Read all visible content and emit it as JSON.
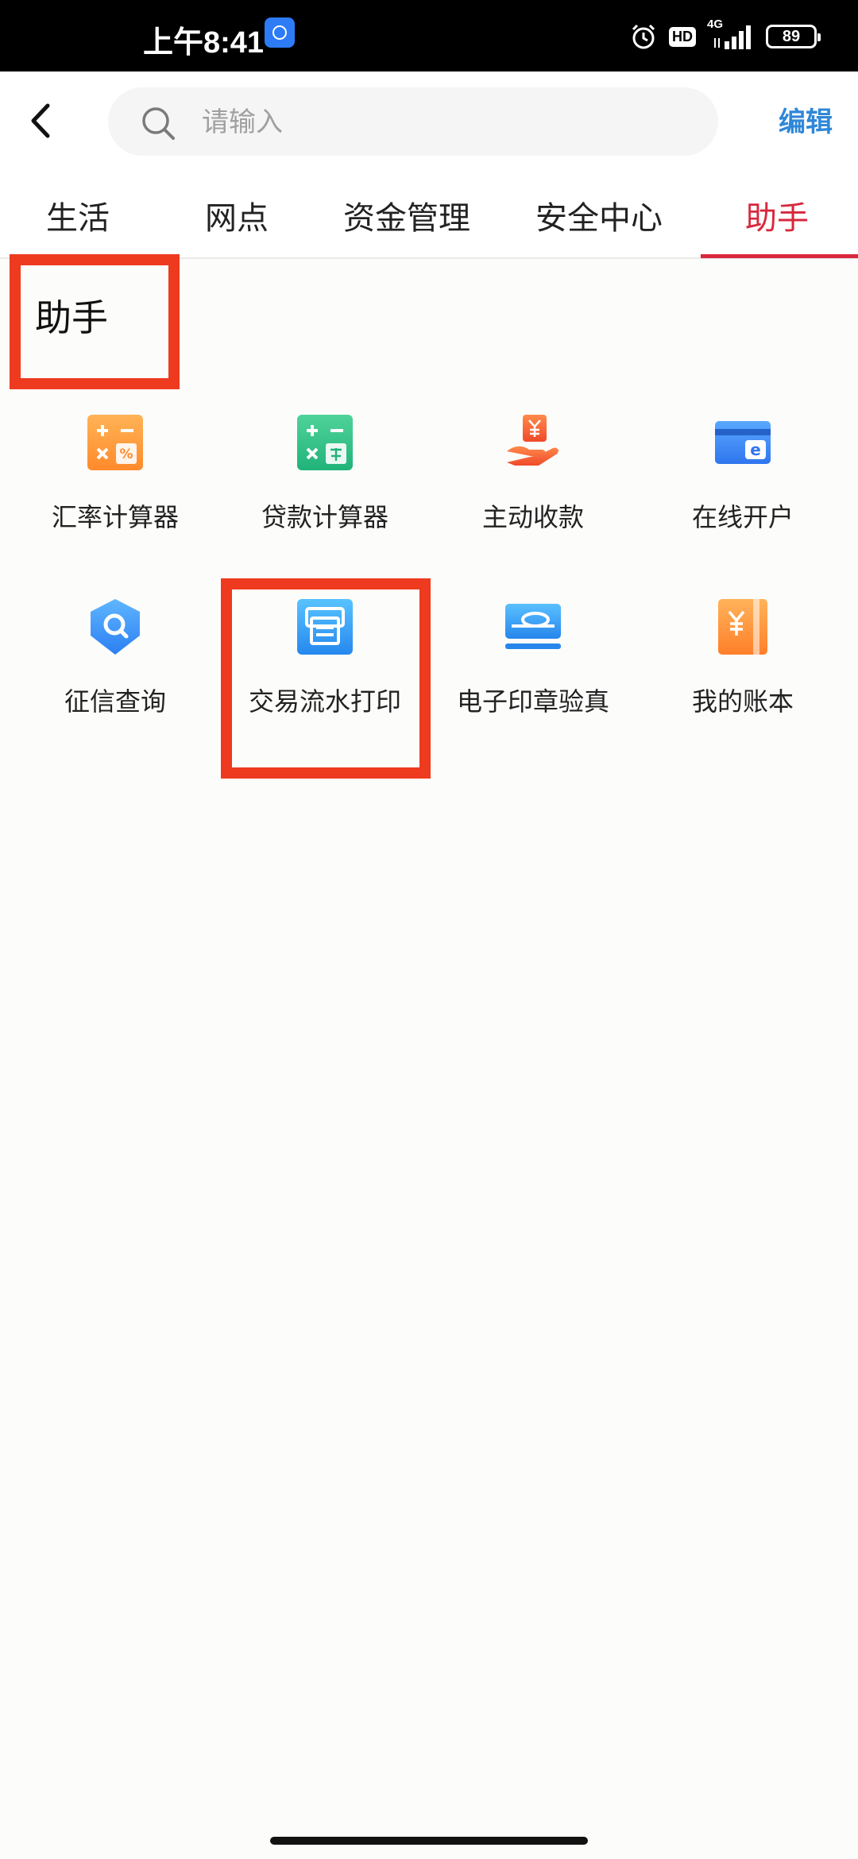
{
  "status_bar": {
    "time": "上午8:41",
    "hd": "HD",
    "network": "4G",
    "battery": "89"
  },
  "header": {
    "back_icon": "chevron-left-icon",
    "search_placeholder": "请输入",
    "edit_label": "编辑"
  },
  "tabs": [
    {
      "label": "生活"
    },
    {
      "label": "网点"
    },
    {
      "label": "资金管理"
    },
    {
      "label": "安全中心"
    },
    {
      "label": "助手",
      "active": true
    }
  ],
  "section": {
    "title": "助手",
    "items": [
      {
        "label": "汇率计算器",
        "icon": "exchange-calculator-icon"
      },
      {
        "label": "贷款计算器",
        "icon": "loan-calculator-icon"
      },
      {
        "label": "主动收款",
        "icon": "receive-payment-icon"
      },
      {
        "label": "在线开户",
        "icon": "online-account-icon"
      },
      {
        "label": "征信查询",
        "icon": "credit-query-icon"
      },
      {
        "label": "交易流水打印",
        "icon": "transaction-print-icon"
      },
      {
        "label": "电子印章验真",
        "icon": "e-seal-verify-icon"
      },
      {
        "label": "我的账本",
        "icon": "ledger-icon"
      }
    ]
  },
  "colors": {
    "accent_red": "#d8283d",
    "edit_blue": "#2f87d9",
    "highlight_red": "#ee3a1f"
  }
}
